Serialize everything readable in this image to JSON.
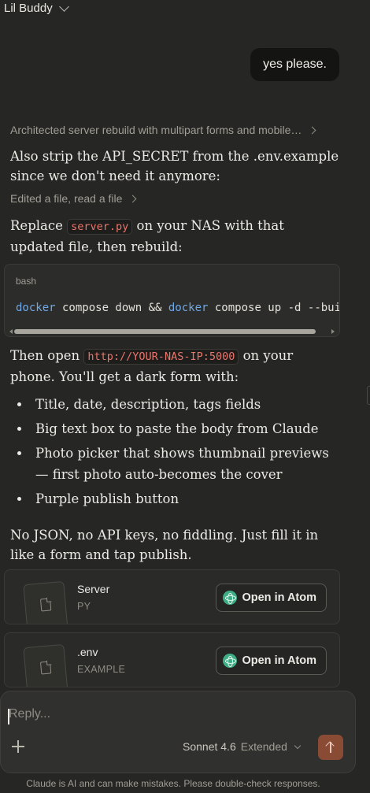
{
  "header": {
    "title": "Lil Buddy"
  },
  "user_message": "yes please.",
  "assistant": {
    "thinking_summary": "Architected server rebuild with multipart forms and mobile…",
    "para1": "Also strip the API_SECRET from the .env.example since we don't need it anymore:",
    "tool_summary": "Edited a file, read a file",
    "para2": {
      "before": "Replace ",
      "code": "server.py",
      "after": " on your NAS with that updated file, then rebuild:"
    },
    "code_block": {
      "language": "bash",
      "tokens": [
        {
          "text": "docker",
          "kind": "kw"
        },
        {
          "text": " compose down && ",
          "kind": "plain"
        },
        {
          "text": "docker",
          "kind": "kw"
        },
        {
          "text": " compose up -d --build",
          "kind": "plain"
        }
      ]
    },
    "para3": {
      "before": "Then open ",
      "code": "http://YOUR-NAS-IP:5000",
      "after": " on your phone. You'll get a dark form with:"
    },
    "bullets": [
      "Title, date, description, tags fields",
      "Big text box to paste the body from Claude",
      "Photo picker that shows thumbnail previews — first photo auto-becomes the cover",
      "Purple publish button"
    ],
    "para4": "No JSON, no API keys, no fiddling. Just fill it in like a form and tap publish."
  },
  "files": [
    {
      "name": "Server",
      "ext": "PY",
      "action": "Open in Atom"
    },
    {
      "name": ".env",
      "ext": "EXAMPLE",
      "action": "Open in Atom"
    }
  ],
  "composer": {
    "placeholder": "Reply...",
    "model": "Sonnet 4.6",
    "mode": "Extended"
  },
  "disclaimer": "Claude is AI and can make mistakes. Please double-check responses.",
  "colors": {
    "background": "#262624",
    "send_button": "#8a4b35",
    "inline_code": "#e9756b",
    "keyword": "#6ea8e8"
  },
  "icons": [
    "chevron-down-icon",
    "chevron-right-icon",
    "document-icon",
    "atom-icon",
    "plus-icon",
    "arrow-up-icon"
  ]
}
